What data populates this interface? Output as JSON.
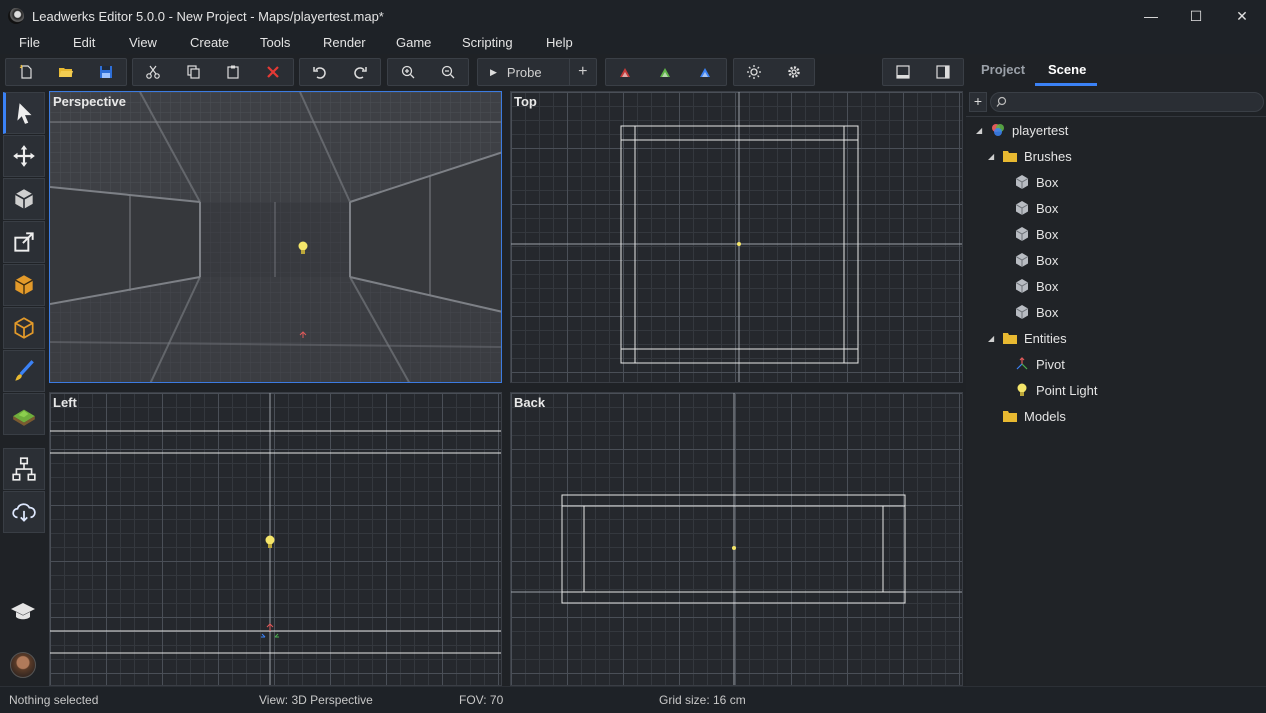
{
  "window": {
    "title": "Leadwerks Editor 5.0.0 - New Project - Maps/playertest.map*",
    "controls": {
      "minimize": "—",
      "maximize": "☐",
      "close": "✕"
    }
  },
  "menu": [
    "File",
    "Edit",
    "View",
    "Create",
    "Tools",
    "Render",
    "Game",
    "Scripting",
    "Help"
  ],
  "toolbar": {
    "probe_label": "Probe",
    "probe_add": "+"
  },
  "viewports": {
    "perspective": "Perspective",
    "top": "Top",
    "left": "Left",
    "back": "Back"
  },
  "panel": {
    "tabs": [
      "Project",
      "Scene"
    ],
    "active_tab": "Scene",
    "add_label": "+",
    "search_placeholder": ""
  },
  "scene_tree": {
    "root": "playertest",
    "brushes_folder": "Brushes",
    "brushes": [
      "Box",
      "Box",
      "Box",
      "Box",
      "Box",
      "Box"
    ],
    "entities_folder": "Entities",
    "entities": [
      "Pivot",
      "Point Light"
    ],
    "models_folder": "Models"
  },
  "status": {
    "selection": "Nothing selected",
    "view": "View: 3D Perspective",
    "fov": "FOV: 70",
    "grid": "Grid size: 16 cm"
  },
  "colors": {
    "accent": "#3b82f6",
    "delete": "#e53935",
    "folder": "#e8b931",
    "light": "#f5e66a"
  }
}
